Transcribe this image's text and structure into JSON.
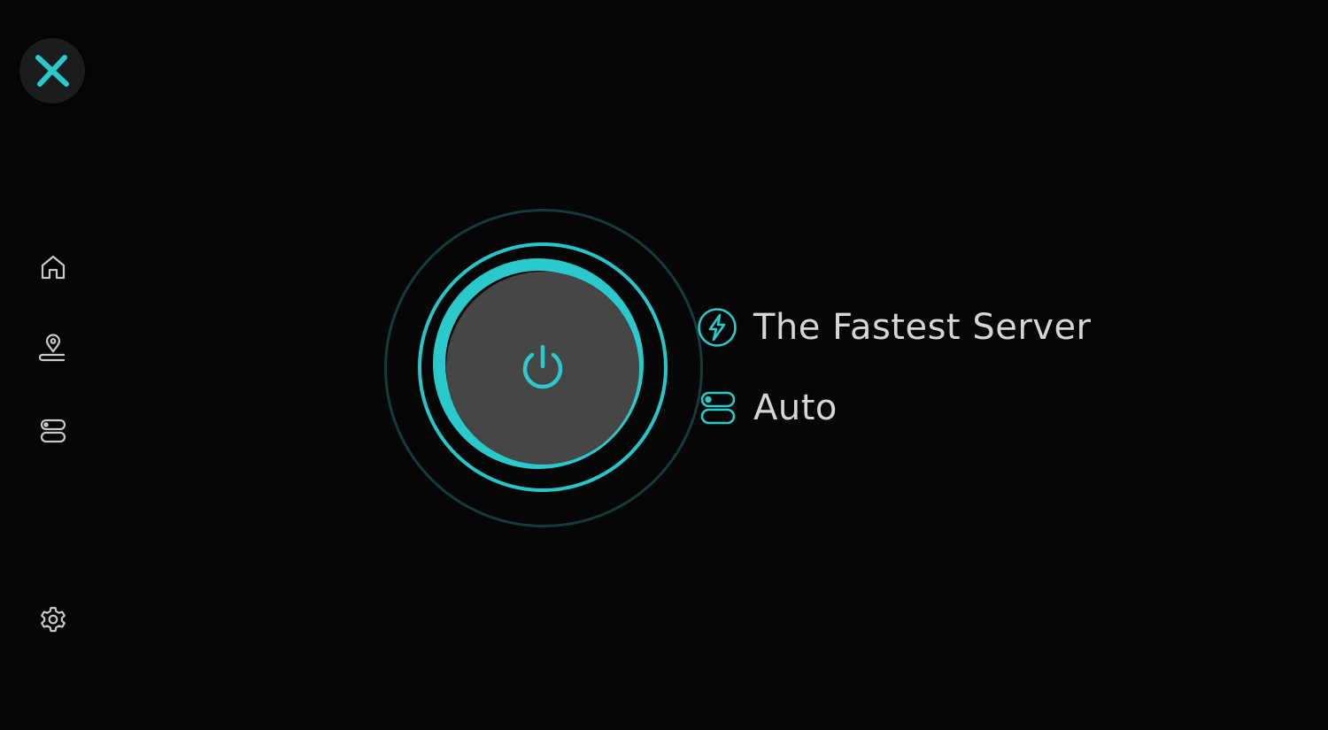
{
  "app": {
    "accent_color": "#2ac9cb",
    "background_color": "#060606"
  },
  "sidebar": {
    "logo_icon": "x-logo-icon",
    "items": [
      {
        "icon": "home-icon"
      },
      {
        "icon": "location-pin-icon"
      },
      {
        "icon": "servers-icon"
      },
      {
        "icon": "gear-icon"
      }
    ]
  },
  "main": {
    "power_icon": "power-icon",
    "server": {
      "icon": "lightning-icon",
      "label": "The Fastest Server"
    },
    "protocol": {
      "icon": "toggle-icon",
      "label": "Auto"
    }
  }
}
